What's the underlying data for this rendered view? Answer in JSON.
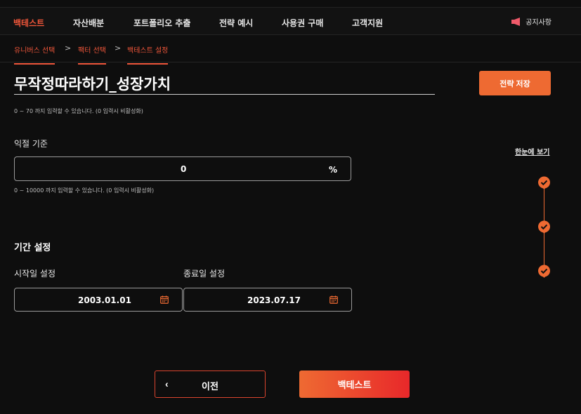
{
  "nav": {
    "items": [
      {
        "label": "백테스트",
        "active": true
      },
      {
        "label": "자산배분"
      },
      {
        "label": "포트폴리오 추출"
      },
      {
        "label": "전략 예시"
      },
      {
        "label": "사용권 구매"
      },
      {
        "label": "고객지원"
      }
    ],
    "notice_label": "공지사항",
    "notice_icon": "megaphone-icon"
  },
  "breadcrumb": {
    "steps": [
      "유니버스 선택",
      "팩터 선택",
      "백테스트 설정"
    ],
    "separator": ">"
  },
  "strategy": {
    "name": "무작정따라하기_성장가치",
    "save_label": "전략 저장",
    "name_hint": "0 ~ 70 까지 입력할 수 있습니다. (0 입력시 비활성화)"
  },
  "take_profit": {
    "label": "익절 기준",
    "value": "0",
    "unit": "%",
    "hint": "0 ~ 10000 까지 입력할 수 있습니다. (0 입력시 비활성화)"
  },
  "period": {
    "title": "기간 설정",
    "start_label": "시작일 설정",
    "start_value": "2003.01.01",
    "end_label": "종료일 설정",
    "end_value": "2023.07.17",
    "calendar_icon": "calendar-icon"
  },
  "sidebar": {
    "overview_label": "한눈에 보기",
    "steps_completed": 3
  },
  "footer": {
    "prev_label": "이전",
    "backtest_label": "백테스트"
  },
  "colors": {
    "accent": "#ee6a32",
    "active_nav": "#f0563a",
    "background": "#0e0e0e"
  }
}
